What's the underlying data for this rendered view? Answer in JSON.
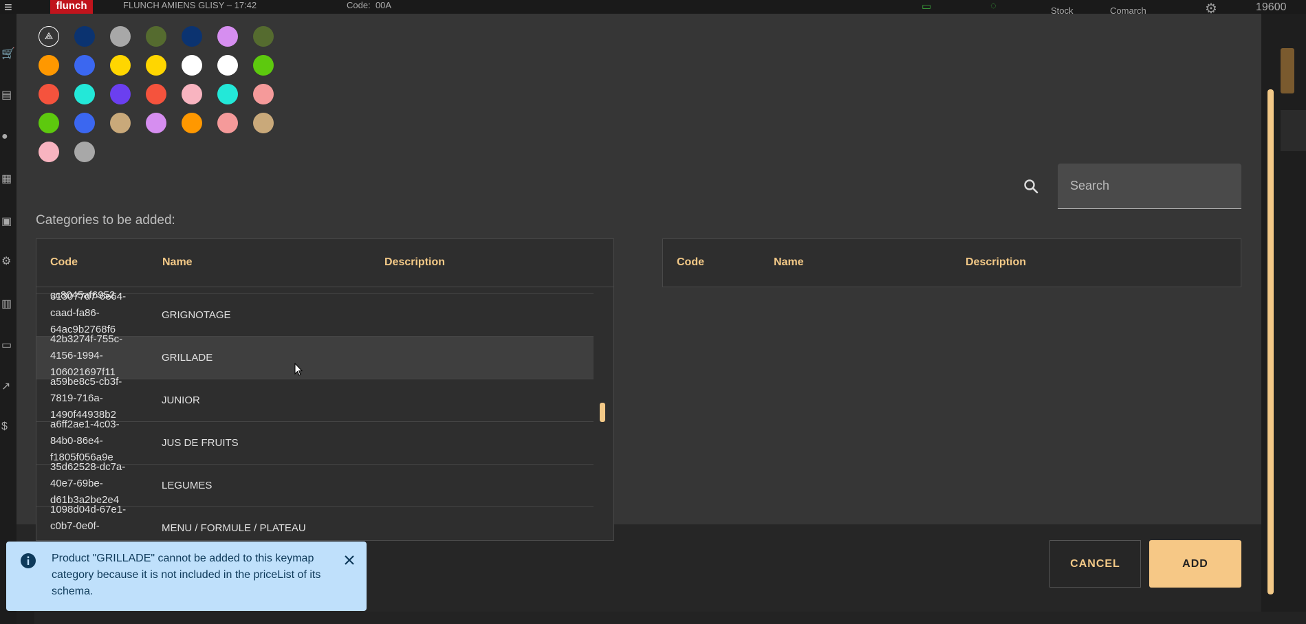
{
  "background": {
    "brand": "flunch",
    "store": "FLUNCH AMIENS GLISY – 17:42",
    "code_label": "Code:",
    "code_value": "00A",
    "stock_label": "Stock",
    "comarch_label": "Comarch",
    "top_number": "19600"
  },
  "colors": {
    "accent": "#f3c987",
    "dialog_bg": "#363636",
    "toast_bg": "#bfe0fb",
    "swatches": [
      "none",
      "#0b3370",
      "#a8a8a8",
      "#556b2f",
      "#0b3370",
      "#d68ef0",
      "#556b2f",
      "#ff9800",
      "#3b67f0",
      "#ffd600",
      "#ffd600",
      "#ffffff",
      "#ffffff",
      "#5dc90e",
      "#f5533d",
      "#23e8d8",
      "#6b3ff0",
      "#f5533d",
      "#f8b4c0",
      "#23e8d8",
      "#f59a9a",
      "#5dc90e",
      "#3b67f0",
      "#c9a97a",
      "#d68ef0",
      "#ff9800",
      "#f59a9a",
      "#c9a97a",
      "#f8b4c0",
      "#a8a8a8"
    ]
  },
  "search": {
    "placeholder": "Search",
    "value": ""
  },
  "section_label": "Categories to be added:",
  "left_table": {
    "headers": {
      "code": "Code",
      "name": "Name",
      "description": "Description"
    },
    "rows": [
      {
        "code": "cc8045af6952",
        "name": "",
        "description": ""
      },
      {
        "code": "313077d7-6e64-caad-fa86-64ac9b2768f6",
        "name": "GRIGNOTAGE",
        "description": ""
      },
      {
        "code": "42b3274f-755c-4156-1994-106021697f11",
        "name": "GRILLADE",
        "description": ""
      },
      {
        "code": "a59be8c5-cb3f-7819-716a-1490f44938b2",
        "name": "JUNIOR",
        "description": ""
      },
      {
        "code": "a6ff2ae1-4c03-84b0-86e4-f1805f056a9e",
        "name": "JUS DE FRUITS",
        "description": ""
      },
      {
        "code": "35d62528-dc7a-40e7-69be-d61b3a2be2e4",
        "name": "LEGUMES",
        "description": ""
      },
      {
        "code": "1098d04d-67e1-c0b7-0e0f-",
        "name": "MENU / FORMULE / PLATEAU",
        "description": ""
      }
    ]
  },
  "right_table": {
    "headers": {
      "code": "Code",
      "name": "Name",
      "description": "Description"
    }
  },
  "buttons": {
    "cancel": "CANCEL",
    "add": "ADD"
  },
  "toast": {
    "message": "Product \"GRILLADE\" cannot be added to this keymap category because it is not included in the priceList of its schema."
  }
}
